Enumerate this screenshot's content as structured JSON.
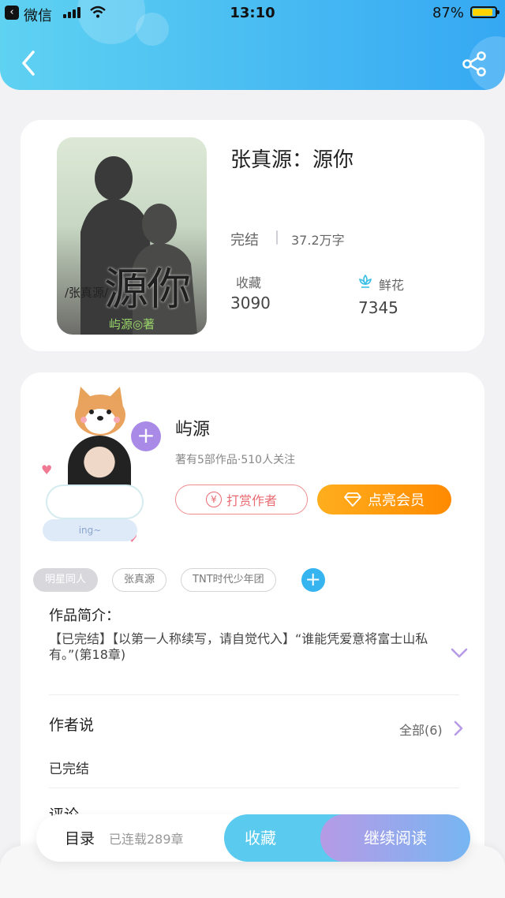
{
  "status_bar": {
    "carrier": "微信",
    "time": "13:10",
    "battery": "87%"
  },
  "book": {
    "title": "张真源：源你",
    "status": "完结",
    "words": "37.2万字",
    "favorites_label": "收藏",
    "favorites_count": "3090",
    "flowers_label": "鲜花",
    "flowers_count": "7345",
    "cover": {
      "title": "源你",
      "tag": "/张真源/",
      "author": "屿源◎著"
    }
  },
  "author": {
    "avatar_caption": "ing~",
    "name": "屿源",
    "meta": "著有5部作品·510人关注",
    "reward_label": "打赏作者",
    "vip_label": "点亮会员"
  },
  "tags": [
    "明星同人",
    "张真源",
    "TNT时代少年团"
  ],
  "intro": {
    "heading": "作品简介：",
    "text": "【已完结】【以第一人称续写，请自觉代入】“谁能凭爱意将富士山私有。”(第18章)"
  },
  "author_says": {
    "heading": "作者说",
    "all_link": "全部(6)",
    "latest": "已完结"
  },
  "comments_heading": "评论",
  "bottom_bar": {
    "toc_label": "目录",
    "serial_text": "已连载289章",
    "favorite_label": "收藏",
    "read_label": "继续阅读"
  }
}
